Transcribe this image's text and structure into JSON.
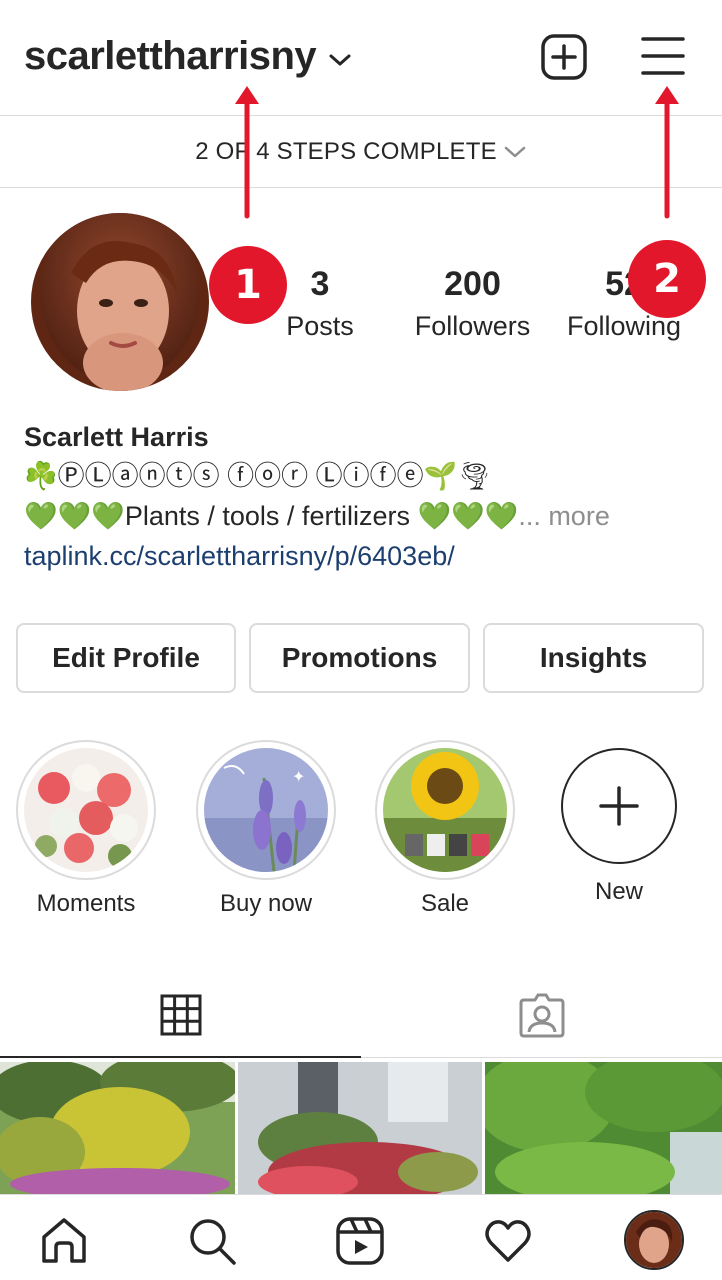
{
  "header": {
    "username": "scarlettharrisny",
    "add_icon": "plus-square-icon",
    "menu_icon": "hamburger-menu-icon"
  },
  "steps": {
    "text": "2 OF 4 STEPS COMPLETE"
  },
  "stats": [
    {
      "value": "3",
      "label": "Posts"
    },
    {
      "value": "200",
      "label": "Followers"
    },
    {
      "value": "52",
      "label": "Following"
    }
  ],
  "bio": {
    "name": "Scarlett Harris",
    "line1": "☘️ⓅⓁⓐⓝⓣⓢ ⓕⓞⓡ Ⓛⓘⓕⓔ🌱🌪",
    "line2": "💚💚💚Plants / tools / fertilizers 💚💚💚",
    "more": "... more",
    "link": "taplink.cc/scarlettharrisny/p/6403eb/"
  },
  "buttons": {
    "edit": "Edit Profile",
    "promotions": "Promotions",
    "insights": "Insights"
  },
  "highlights": [
    {
      "label": "Moments"
    },
    {
      "label": "Buy now"
    },
    {
      "label": "Sale"
    },
    {
      "label": "New"
    }
  ],
  "tabs": {
    "grid_icon": "grid-icon",
    "tagged_icon": "tagged-person-icon"
  },
  "nav": {
    "home_icon": "home-icon",
    "search_icon": "search-icon",
    "reels_icon": "reels-icon",
    "activity_icon": "heart-icon",
    "profile": "profile-avatar"
  },
  "annotations": [
    {
      "label": "1"
    },
    {
      "label": "2"
    }
  ],
  "colors": {
    "annotation_red": "#e3172b",
    "link_blue": "#1d3f70",
    "border": "#dbdbdb",
    "text": "#262626"
  }
}
